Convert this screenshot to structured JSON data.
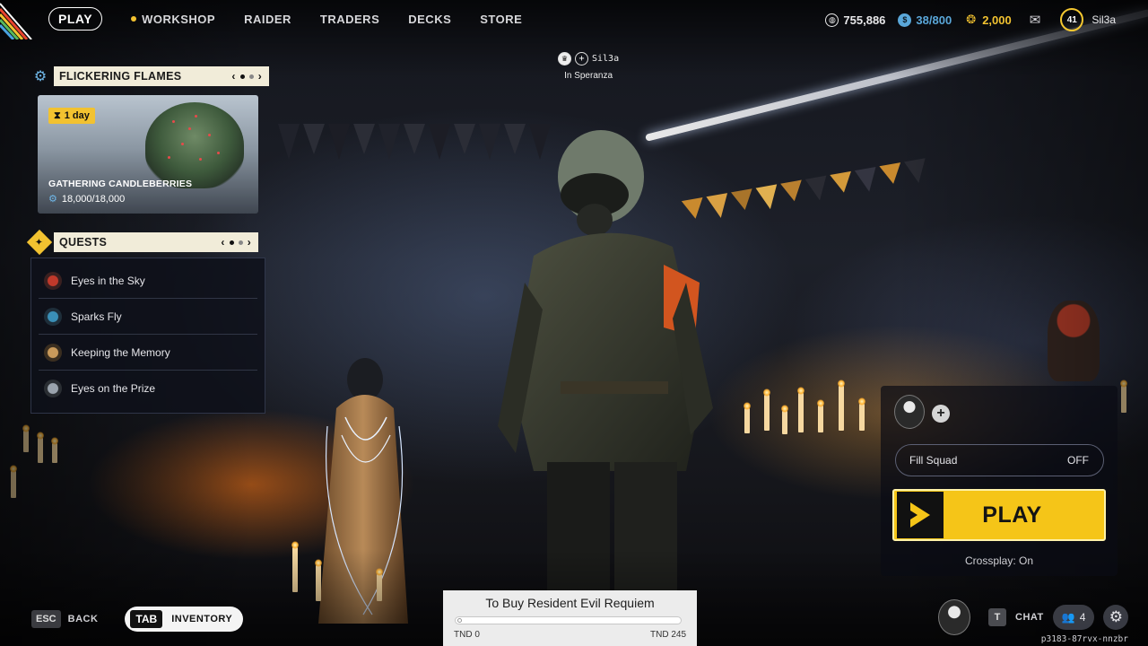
{
  "nav": {
    "play_label": "PLAY",
    "items": [
      "WORKSHOP",
      "RAIDER",
      "TRADERS",
      "DECKS",
      "STORE"
    ]
  },
  "currencies": {
    "coins": "755,886",
    "seeds": "38/800",
    "premium": "2,000",
    "level": "41",
    "username": "Sil3a"
  },
  "event": {
    "title": "FLICKERING FLAMES",
    "timer": "1 day",
    "task": "GATHERING CANDLEBERRIES",
    "progress": "18,000/18,000"
  },
  "quests": {
    "title": "QUESTS",
    "items": [
      {
        "label": "Eyes in the Sky",
        "color": "#c0392b"
      },
      {
        "label": "Sparks Fly",
        "color": "#3a8fb7"
      },
      {
        "label": "Keeping the Memory",
        "color": "#c99a5b"
      },
      {
        "label": "Eyes on the Prize",
        "color": "#9aa3ad"
      }
    ]
  },
  "player_tag": {
    "name": "Sil3a",
    "location": "In Speranza"
  },
  "squad": {
    "fill_label": "Fill Squad",
    "fill_value": "OFF",
    "play_label": "PLAY",
    "crossplay": "Crossplay: On"
  },
  "bottom": {
    "back_key": "ESC",
    "back_label": "BACK",
    "inventory_key": "TAB",
    "inventory_label": "INVENTORY",
    "chat_key": "T",
    "chat_label": "CHAT",
    "friends_count": "4",
    "build_id": "p3183-87rvx-nnzbr"
  },
  "goal": {
    "title": "To Buy Resident Evil Requiem",
    "min_label": "TND 0",
    "max_label": "TND 245",
    "progress_fraction": 0.0
  },
  "colors": {
    "accent_yellow": "#f2c230",
    "play_yellow": "#f5c518",
    "seed_blue": "#5aa7d9"
  }
}
